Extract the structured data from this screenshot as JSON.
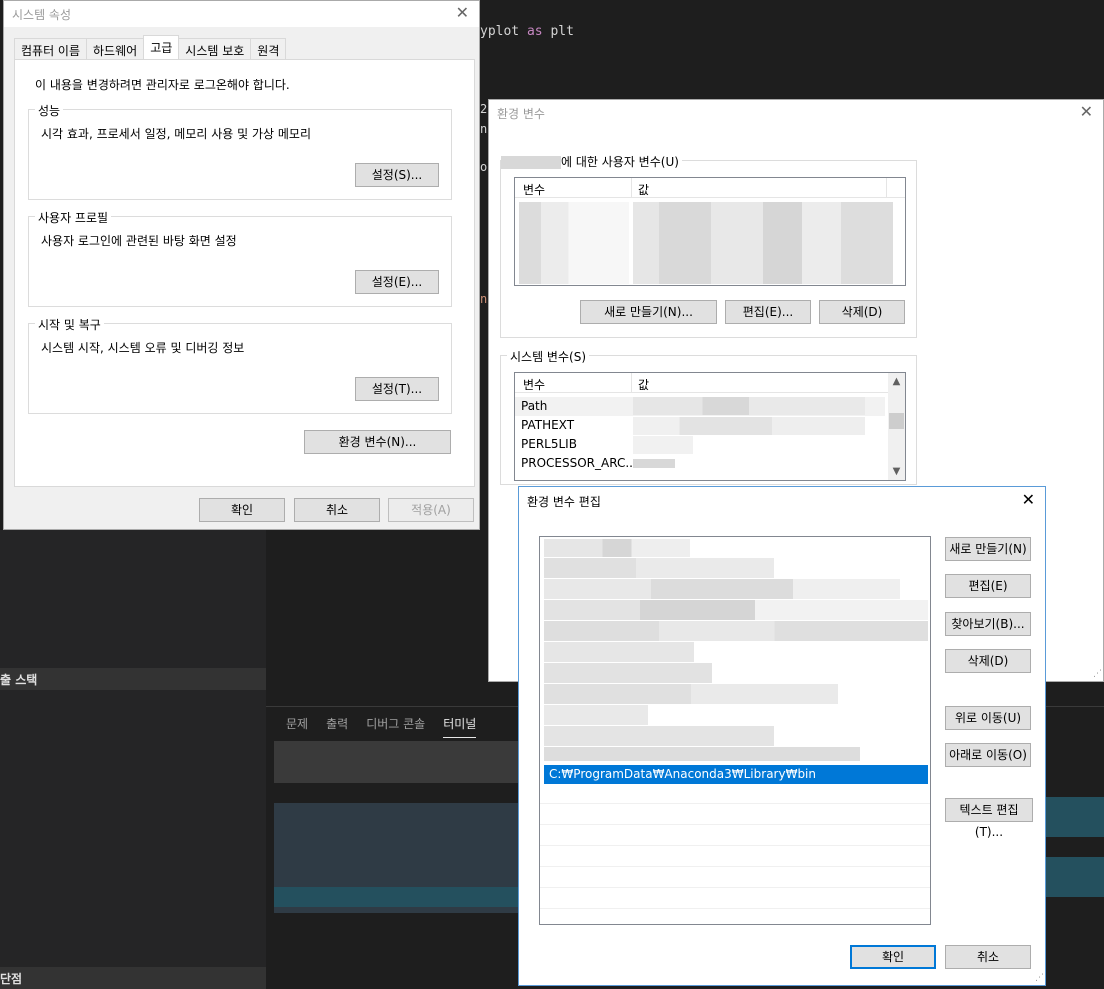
{
  "editor": {
    "code_text": "yplot ",
    "code_kw": "as",
    "code_tail": " plt",
    "edge_char_1": "2",
    "edge_char_2": "n",
    "edge_char_3": "o",
    "edge_char_4": "n"
  },
  "side_panel": {
    "callstack_header": "출 스택",
    "breakpoints_header": "단점"
  },
  "panel": {
    "tabs": [
      "문제",
      "출력",
      "디버그 콘솔",
      "터미널"
    ]
  },
  "sys_props": {
    "title": "시스템 속성",
    "tabs": [
      "컴퓨터 이름",
      "하드웨어",
      "고급",
      "시스템 보호",
      "원격"
    ],
    "admin_note": "이 내용을 변경하려면 관리자로 로그온해야 합니다.",
    "performance": {
      "legend": "성능",
      "desc": "시각 효과, 프로세서 일정, 메모리 사용 및 가상 메모리",
      "button": "설정(S)..."
    },
    "user_profile": {
      "legend": "사용자 프로필",
      "desc": "사용자 로그인에 관련된 바탕 화면 설정",
      "button": "설정(E)..."
    },
    "startup": {
      "legend": "시작 및 복구",
      "desc": "시스템 시작, 시스템 오류 및 디버깅 정보",
      "button": "설정(T)..."
    },
    "env_button": "환경 변수(N)...",
    "ok": "확인",
    "cancel": "취소",
    "apply": "적용(A)"
  },
  "env_vars": {
    "title": "환경 변수",
    "user_group": "에 대한 사용자 변수(U)",
    "col_var": "변수",
    "col_val": "값",
    "user_buttons": {
      "new": "새로 만들기(N)...",
      "edit": "편집(E)...",
      "delete": "삭제(D)"
    },
    "system_group": "시스템 변수(S)",
    "system_rows": [
      "Path",
      "PATHEXT",
      "PERL5LIB",
      "PROCESSOR_ARC..."
    ]
  },
  "edit_env": {
    "title": "환경 변수 편집",
    "selected_entry": "C:₩ProgramData₩Anaconda3₩Library₩bin",
    "buttons": {
      "new": "새로 만들기(N)",
      "edit": "편집(E)",
      "browse": "찾아보기(B)...",
      "delete": "삭제(D)",
      "move_up": "위로 이동(U)",
      "move_down": "아래로 이동(O)",
      "edit_text": "텍스트 편집(T)..."
    },
    "ok": "확인",
    "cancel": "취소"
  },
  "colors": {
    "selection": "#0078d7",
    "editor_bg": "#1e1e1e",
    "keyword": "#c586c0"
  },
  "icons": [
    "close-icon",
    "scroll-up-icon",
    "scroll-down-icon",
    "resize-grip-icon"
  ]
}
